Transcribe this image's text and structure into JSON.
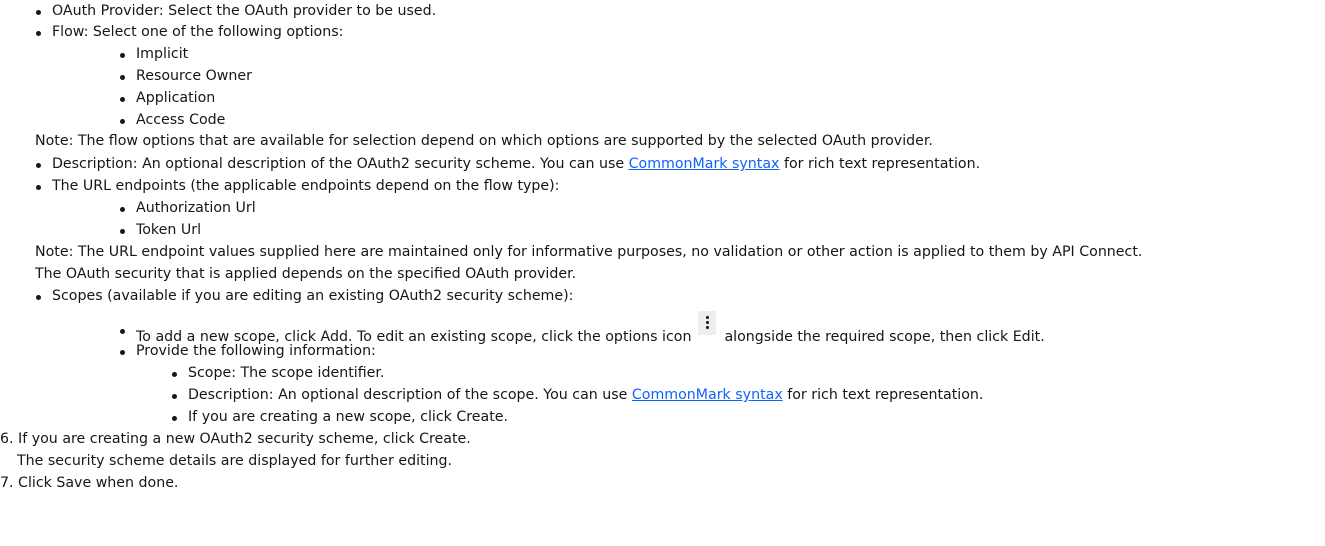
{
  "icons": {
    "options_icon": "overflow-menu-vertical-icon"
  },
  "colors": {
    "link": "#0f62fe",
    "text": "#161616"
  },
  "list": {
    "oauth_provider": "OAuth Provider: Select the OAuth provider to be used.",
    "flow": {
      "label": "Flow: Select one of the following options:",
      "options": [
        "Implicit",
        "Resource Owner",
        "Application",
        "Access Code"
      ],
      "note": "Note: The flow options that are available for selection depend on which options are supported by the selected OAuth provider."
    },
    "description": {
      "before": "Description: An optional description of the OAuth2 security scheme. You can use ",
      "link": "CommonMark syntax",
      "after": " for rich text representation."
    },
    "url_endpoints": {
      "label": "The URL endpoints (the applicable endpoints depend on the flow type):",
      "items": [
        "Authorization Url",
        "Token Url"
      ],
      "note_line1": "Note: The URL endpoint values supplied here are maintained only for informative purposes, no validation or other action is applied to them by API Connect.",
      "note_line2": "The OAuth security that is applied depends on the specified OAuth provider."
    },
    "scopes": {
      "label": "Scopes (available if you are editing an existing OAuth2 security scheme):",
      "add_before": "To add a new scope, click Add. To edit an existing scope, click the options icon ",
      "add_after": " alongside the required scope, then click Edit.",
      "provide": "Provide the following information:",
      "scope_id": "Scope: The scope identifier.",
      "desc_before": "Description: An optional description of the scope. You can use ",
      "desc_link": "CommonMark syntax",
      "desc_after": " for rich text representation.",
      "create": "If you are creating a new scope, click Create."
    }
  },
  "steps": {
    "step6": "6. If you are creating a new OAuth2 security scheme, click Create.",
    "step6_detail": "The security scheme details are displayed for further editing.",
    "step7": "7. Click Save when done."
  }
}
